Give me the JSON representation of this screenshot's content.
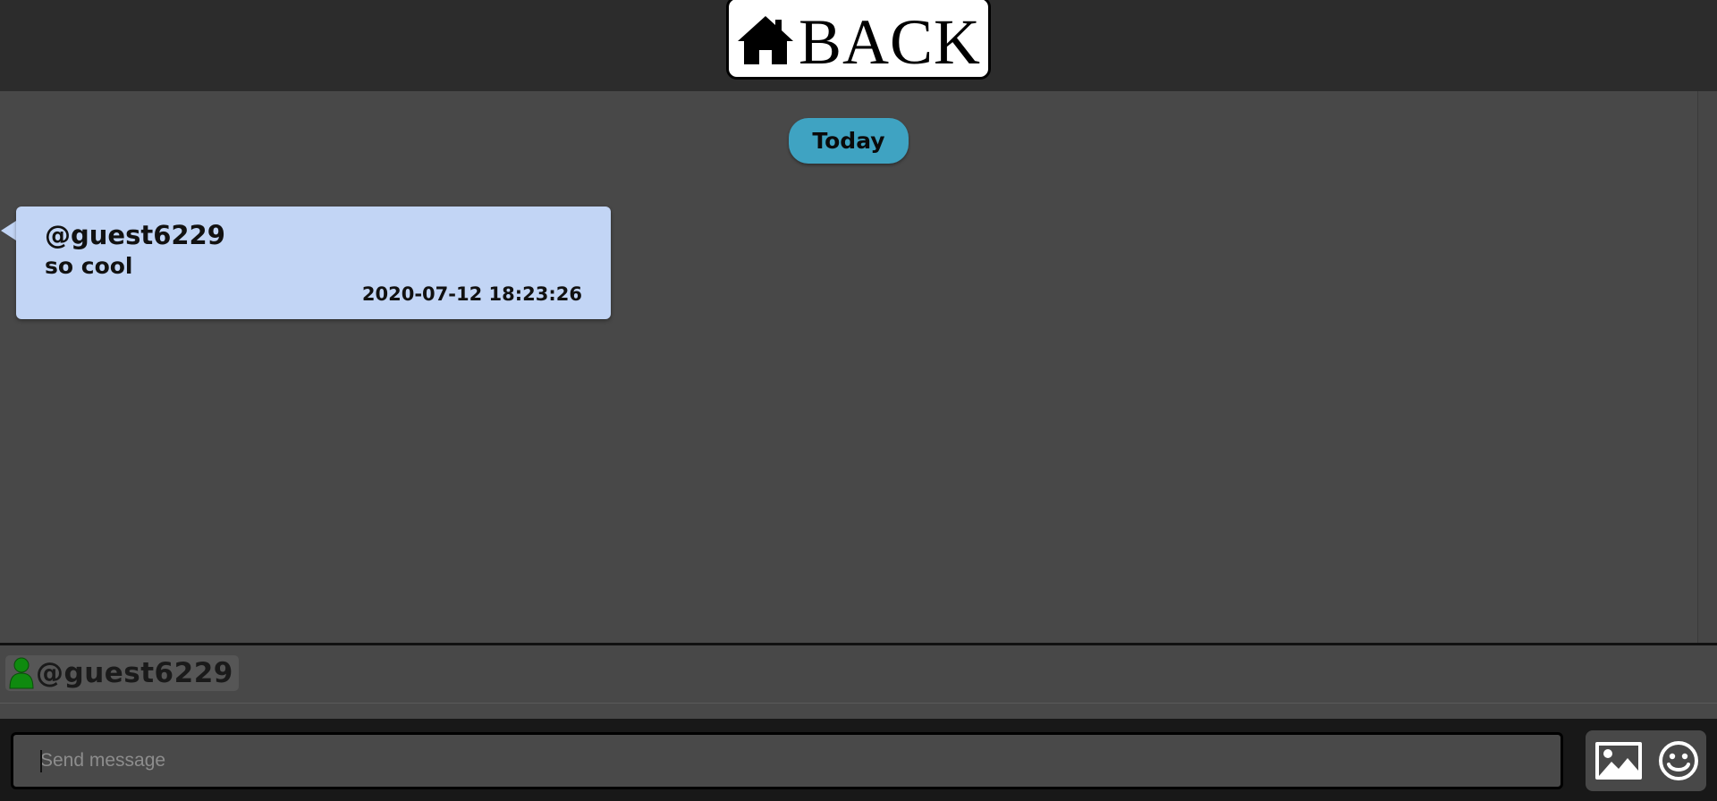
{
  "header": {
    "back_label": "BACK",
    "back_icon": "home-icon"
  },
  "chat": {
    "date_separator": "Today",
    "messages": [
      {
        "user": "@guest6229",
        "text": "so cool",
        "timestamp": "2020-07-12 18:23:26"
      }
    ]
  },
  "online_users": [
    {
      "name": "@guest6229",
      "icon": "person-icon",
      "status_color": "#0f8a0f"
    }
  ],
  "composer": {
    "placeholder": "Send message",
    "value": "",
    "image_icon": "image-icon",
    "emoji_icon": "smiley-icon"
  },
  "colors": {
    "header_bg": "#2c2c2c",
    "chat_bg": "#484848",
    "date_pill": "#3fa3c2",
    "bubble": "#c2d5f5",
    "input_bar_bg": "#181818"
  }
}
